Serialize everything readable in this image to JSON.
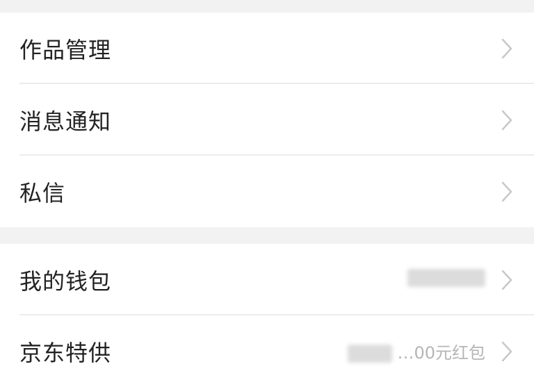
{
  "groups": [
    {
      "items": [
        {
          "label": "作品管理"
        },
        {
          "label": "消息通知"
        },
        {
          "label": "私信"
        }
      ]
    },
    {
      "items": [
        {
          "label": "我的钱包"
        },
        {
          "label": "京东特供",
          "value": "…00元红包"
        }
      ]
    }
  ],
  "icons": {
    "chevron": "chevron-right-icon"
  },
  "colors": {
    "background": "#f2f2f2",
    "card": "#ffffff",
    "text": "#222222",
    "chevron": "#c8c8c8"
  }
}
